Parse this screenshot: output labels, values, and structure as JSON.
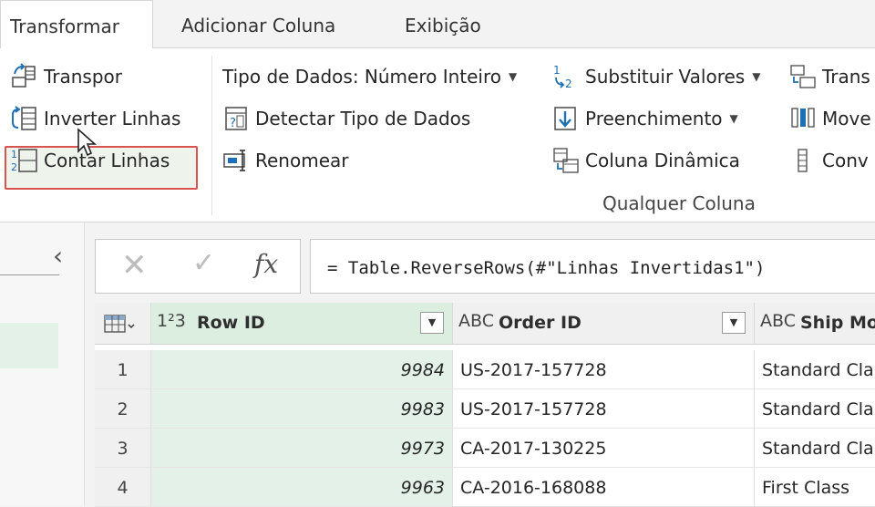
{
  "tabs": [
    {
      "label": "Transformar",
      "active": true
    },
    {
      "label": "Adicionar Coluna",
      "active": false
    },
    {
      "label": "Exibição",
      "active": false
    }
  ],
  "ribbon": {
    "table_group": {
      "transpose": "Transpor",
      "reverse_rows": "Inverter Linhas",
      "count_rows": "Contar Linhas"
    },
    "any_column_group": {
      "data_type": "Tipo de Dados: Número Inteiro",
      "detect_data_type": "Detectar Tipo de Dados",
      "rename": "Renomear",
      "replace_values": "Substituir Valores",
      "fill": "Preenchimento",
      "pivot_column": "Coluna Dinâmica",
      "label": "Qualquer Coluna"
    },
    "right_cut": {
      "transform": "Trans",
      "move": "Move",
      "convert": "Conv"
    }
  },
  "formula": {
    "cancel_glyph": "✕",
    "confirm_glyph": "✓",
    "fx_glyph": "fx",
    "text": "= Table.ReverseRows(#\"Linhas Invertidas1\")"
  },
  "grid": {
    "columns": [
      {
        "type": "1²3",
        "name": "Row ID"
      },
      {
        "type": "ABC",
        "name": "Order ID"
      },
      {
        "type": "ABC",
        "name": "Ship Mo"
      }
    ],
    "rows": [
      {
        "idx": "1",
        "row_id": "9984",
        "order_id": "US-2017-157728",
        "ship_mode": "Standard Cla"
      },
      {
        "idx": "2",
        "row_id": "9983",
        "order_id": "US-2017-157728",
        "ship_mode": "Standard Cla"
      },
      {
        "idx": "3",
        "row_id": "9973",
        "order_id": "CA-2017-130225",
        "ship_mode": "Standard Cla"
      },
      {
        "idx": "4",
        "row_id": "9963",
        "order_id": "CA-2016-168088",
        "ship_mode": "First Class"
      }
    ]
  },
  "colors": {
    "accent_highlight_border": "#d9534f",
    "selected_column_bg": "#e3f1e8",
    "icon_blue": "#1f6fb5"
  }
}
